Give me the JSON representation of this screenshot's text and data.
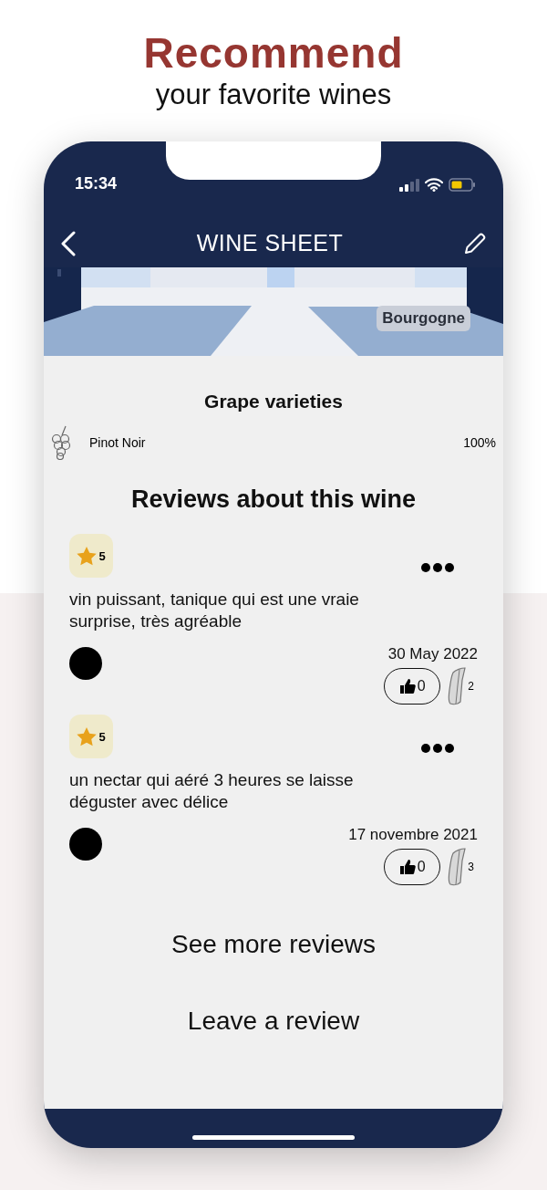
{
  "headline": {
    "title": "Recommend",
    "subtitle": "your favorite wines"
  },
  "status_bar": {
    "time": "15:34"
  },
  "header": {
    "title": "WINE SHEET"
  },
  "banner": {
    "region": "Bourgogne"
  },
  "grapes": {
    "title": "Grape varieties",
    "items": [
      {
        "name": "Pinot Noir",
        "share": "100%"
      }
    ]
  },
  "reviews": {
    "title": "Reviews about this wine",
    "items": [
      {
        "rating": "5",
        "text": "vin puissant, tanique qui est une vraie surprise, très agréable",
        "date": "30 May 2022",
        "likes": "0",
        "comments": "2"
      },
      {
        "rating": "5",
        "text": "un nectar qui aéré 3 heures se laisse déguster avec délice",
        "date": "17 novembre 2021",
        "likes": "0",
        "comments": "3"
      }
    ]
  },
  "actions": [
    "See more reviews",
    "Leave a review"
  ]
}
